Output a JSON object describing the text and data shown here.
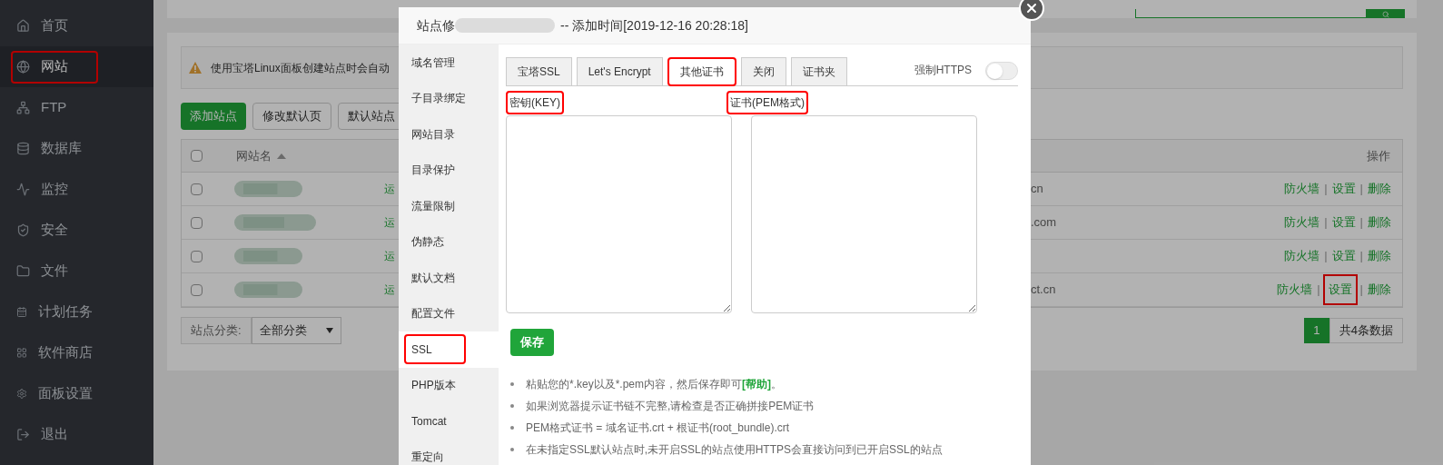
{
  "sidebar": {
    "items": [
      {
        "label": "首页",
        "selected": false,
        "highlighted": false
      },
      {
        "label": "网站",
        "selected": true,
        "highlighted": true
      },
      {
        "label": "FTP",
        "selected": false,
        "highlighted": false
      },
      {
        "label": "数据库",
        "selected": false,
        "highlighted": false
      },
      {
        "label": "监控",
        "selected": false,
        "highlighted": false
      },
      {
        "label": "安全",
        "selected": false,
        "highlighted": false
      },
      {
        "label": "文件",
        "selected": false,
        "highlighted": false
      },
      {
        "label": "计划任务",
        "selected": false,
        "highlighted": false
      },
      {
        "label": "软件商店",
        "selected": false,
        "highlighted": false
      },
      {
        "label": "面板设置",
        "selected": false,
        "highlighted": false
      },
      {
        "label": "退出",
        "selected": false,
        "highlighted": false
      }
    ]
  },
  "notice": {
    "text": "使用宝塔Linux面板创建站点时会自动"
  },
  "toolbar": {
    "buttons": [
      {
        "label": "添加站点",
        "kind": "primary"
      },
      {
        "label": "修改默认页",
        "kind": "default"
      },
      {
        "label": "默认站点",
        "kind": "default"
      }
    ]
  },
  "table": {
    "columns": [
      "网站名",
      "操作"
    ],
    "select_all_checked": false,
    "separator": "|",
    "rows": [
      {
        "checked": false,
        "status": "运",
        "domain": "cn",
        "actions": [
          {
            "label": "防火墙",
            "highlighted": false
          },
          {
            "label": "设置",
            "highlighted": false
          },
          {
            "label": "删除",
            "highlighted": false
          }
        ]
      },
      {
        "checked": false,
        "status": "运",
        "domain": ".com",
        "actions": [
          {
            "label": "防火墙",
            "highlighted": false
          },
          {
            "label": "设置",
            "highlighted": false
          },
          {
            "label": "删除",
            "highlighted": false
          }
        ]
      },
      {
        "checked": false,
        "status": "运",
        "actions": [
          {
            "label": "防火墙",
            "highlighted": false
          },
          {
            "label": "设置",
            "highlighted": false
          },
          {
            "label": "删除",
            "highlighted": false
          }
        ]
      },
      {
        "checked": false,
        "status": "运",
        "domain": "ct.cn",
        "actions": [
          {
            "label": "防火墙",
            "highlighted": false
          },
          {
            "label": "设置",
            "highlighted": true
          },
          {
            "label": "删除",
            "highlighted": false
          }
        ]
      }
    ]
  },
  "footer": {
    "category_label": "站点分类:",
    "category_value": "全部分类",
    "pages": [
      {
        "label": "1",
        "selected": true
      }
    ],
    "total": "共4条数据"
  },
  "modal": {
    "title_start": "站点修",
    "title_end": "-- 添加时间[2019-12-16 20:28:18]",
    "nav": [
      {
        "label": "域名管理",
        "selected": false,
        "highlighted": false
      },
      {
        "label": "子目录绑定",
        "selected": false,
        "highlighted": false
      },
      {
        "label": "网站目录",
        "selected": false,
        "highlighted": false
      },
      {
        "label": "目录保护",
        "selected": false,
        "highlighted": false
      },
      {
        "label": "流量限制",
        "selected": false,
        "highlighted": false
      },
      {
        "label": "伪静态",
        "selected": false,
        "highlighted": false
      },
      {
        "label": "默认文档",
        "selected": false,
        "highlighted": false
      },
      {
        "label": "配置文件",
        "selected": false,
        "highlighted": false
      },
      {
        "label": "SSL",
        "selected": true,
        "highlighted": true
      },
      {
        "label": "PHP版本",
        "selected": false,
        "highlighted": false
      },
      {
        "label": "Tomcat",
        "selected": false,
        "highlighted": false
      },
      {
        "label": "重定向",
        "selected": false,
        "highlighted": false
      }
    ],
    "tabs": [
      {
        "label": "宝塔SSL",
        "selected": false,
        "highlighted": false
      },
      {
        "label": "Let's Encrypt",
        "selected": false,
        "highlighted": false
      },
      {
        "label": "其他证书",
        "selected": true,
        "highlighted": true
      },
      {
        "label": "关闭",
        "selected": false,
        "highlighted": false
      },
      {
        "label": "证书夹",
        "selected": false,
        "highlighted": false
      }
    ],
    "force_https": {
      "label": "强制HTTPS",
      "on": false
    },
    "fields": [
      {
        "label": "密钥(KEY)",
        "highlighted": true
      },
      {
        "label": "证书(PEM格式)",
        "highlighted": true
      }
    ],
    "save_button": "保存",
    "notes": [
      "粘贴您的*.key以及*.pem内容，然后保存即可**[帮助]**。",
      "如果浏览器提示证书链不完整,请检查是否正确拼接PEM证书",
      "PEM格式证书 = 域名证书.crt + 根证书(root_bundle).crt",
      "在未指定SSL默认站点时,未开启SSL的站点使用HTTPS会直接访问到已开启SSL的站点"
    ]
  }
}
